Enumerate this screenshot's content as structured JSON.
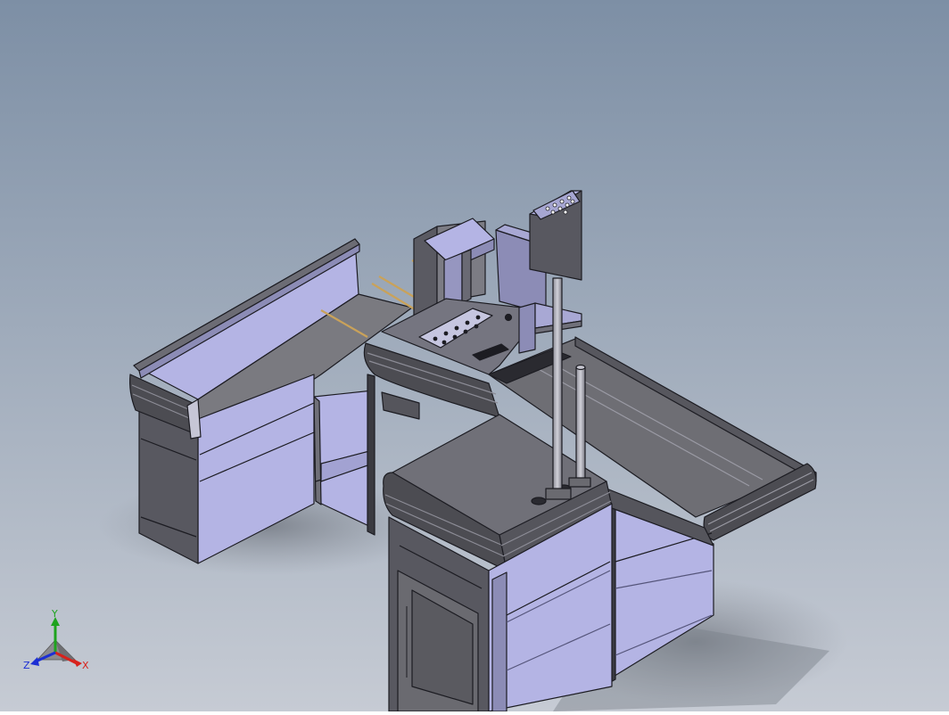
{
  "viewport": {
    "background_top": "#7d8fa5",
    "background_bottom": "#c6cbd4",
    "model": "checkout-counter-assembly"
  },
  "colors": {
    "edge": "#1c1c22",
    "panel_light": "#b4b4e4",
    "panel_mid": "#8c8cb6",
    "panel_dark": "#54545c",
    "top_dark": "#6a6a70",
    "bumper": "#4c4c52",
    "rod": "#c9a25a",
    "shadow": "#8a8f98"
  },
  "triad": {
    "x_label": "X",
    "y_label": "Y",
    "z_label": "Z",
    "x_color": "#d8221c",
    "y_color": "#1ea31e",
    "z_color": "#1c2fd4"
  }
}
